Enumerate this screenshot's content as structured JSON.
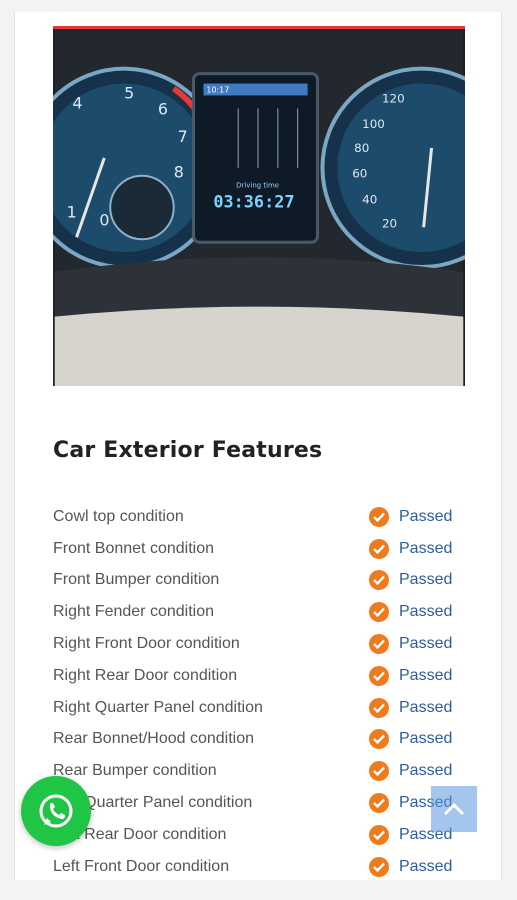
{
  "dashboard": {
    "time_display": "03:36:27",
    "driving_time_label": "Driving time",
    "clock": "10:17"
  },
  "section": {
    "title": "Car Exterior Features"
  },
  "features": [
    {
      "label": "Cowl top condition",
      "status": "Passed"
    },
    {
      "label": "Front Bonnet condition",
      "status": "Passed"
    },
    {
      "label": "Front Bumper condition",
      "status": "Passed"
    },
    {
      "label": "Right Fender condition",
      "status": "Passed"
    },
    {
      "label": "Right Front Door condition",
      "status": "Passed"
    },
    {
      "label": "Right Rear Door condition",
      "status": "Passed"
    },
    {
      "label": "Right Quarter Panel condition",
      "status": "Passed"
    },
    {
      "label": "Rear Bonnet/Hood condition",
      "status": "Passed"
    },
    {
      "label": "Rear Bumper condition",
      "status": "Passed"
    },
    {
      "label": "Left Quarter Panel condition",
      "status": "Passed"
    },
    {
      "label": "Left Rear Door condition",
      "status": "Passed"
    },
    {
      "label": "Left Front Door condition",
      "status": "Passed"
    }
  ],
  "colors": {
    "accent_orange": "#f07a1e",
    "status_blue": "#2a5d9f",
    "whatsapp_green": "#21c546"
  },
  "icons": {
    "status": "check-circle-icon",
    "whatsapp": "whatsapp-icon",
    "scroll_top": "chevron-up-icon"
  }
}
